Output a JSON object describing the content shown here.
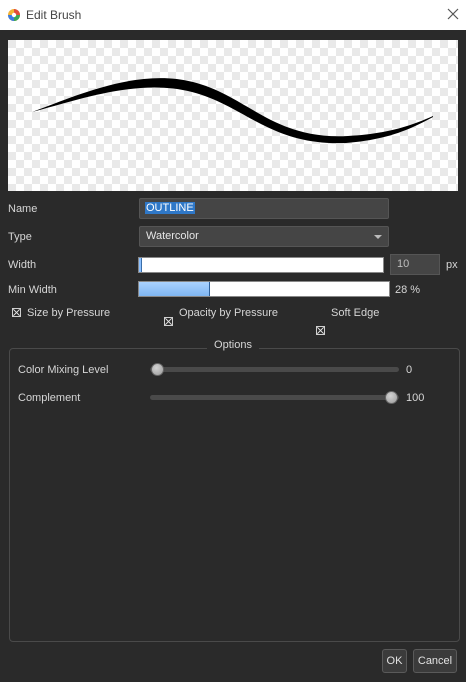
{
  "window": {
    "title": "Edit Brush"
  },
  "fields": {
    "name": {
      "label": "Name",
      "value": "OUTLINE"
    },
    "type": {
      "label": "Type",
      "value": "Watercolor"
    },
    "width": {
      "label": "Width",
      "value": "10",
      "unit": "px",
      "fill_fraction": 0.01
    },
    "min_width": {
      "label": "Min Width",
      "value": "28 %",
      "fill_fraction": 0.28
    }
  },
  "checkboxes": [
    {
      "label": "Size by Pressure",
      "checked": true
    },
    {
      "label": "Opacity by Pressure",
      "checked": true
    },
    {
      "label": "Soft Edge",
      "checked": true
    }
  ],
  "options": {
    "title": "Options",
    "color_mixing": {
      "label": "Color Mixing Level",
      "value": "0",
      "fraction": 0.0
    },
    "complement": {
      "label": "Complement",
      "value": "100",
      "fraction": 1.0
    }
  },
  "buttons": {
    "ok": "OK",
    "cancel": "Cancel"
  },
  "colors": {
    "accent": "#8cc0ff",
    "selection": "#2f78c8",
    "background": "#2a2a2a"
  },
  "icons": {
    "app": "color-wheel-icon",
    "close": "close-icon",
    "dropdown": "chevron-down-icon"
  }
}
